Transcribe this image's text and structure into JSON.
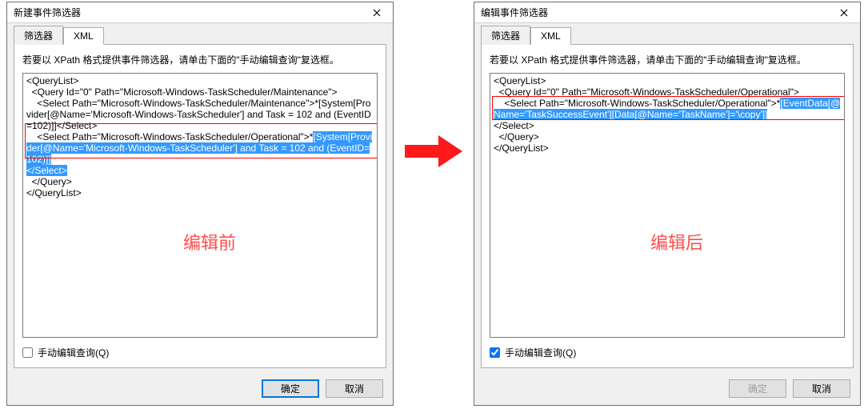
{
  "left": {
    "title": "新建事件筛选器",
    "tab_filter": "筛选器",
    "tab_xml": "XML",
    "instruction": "若要以 XPath 格式提供事件筛选器，请单击下面的\"手动编辑查询\"复选框。",
    "xml_lines": [
      "<QueryList>",
      "  <Query Id=\"0\" Path=\"Microsoft-Windows-TaskScheduler/Maintenance\">",
      "    <Select Path=\"Microsoft-Windows-TaskScheduler/Maintenance\">*[System[Provider[@Name='Microsoft-Windows-TaskScheduler'] and Task = 102 and (EventID=102)]]</Select>",
      "    <Select Path=\"Microsoft-Windows-TaskScheduler/Operational\">*",
      "</Select>",
      "  </Query>",
      "</QueryList>"
    ],
    "xml_highlight": "[System[Provider[@Name='Microsoft-Windows-TaskScheduler'] and Task = 102 and (EventID=102)]]",
    "xml_sel_prefix": "    <Select Path=\"Microsoft-Windows-TaskScheduler/Operational\">*",
    "checkbox_label": "手动编辑查询(Q)",
    "checkbox_checked": false,
    "ok": "确定",
    "cancel": "取消",
    "annotation": "编辑前"
  },
  "right": {
    "title": "编辑事件筛选器",
    "tab_filter": "筛选器",
    "tab_xml": "XML",
    "instruction": "若要以 XPath 格式提供事件筛选器，请单击下面的\"手动编辑查询\"复选框。",
    "xml_q1": "<QueryList>",
    "xml_q2": "  <Query Id=\"0\" Path=\"Microsoft-Windows-TaskScheduler/Operational\">",
    "xml_sel_prefix": "    <Select Path=\"Microsoft-Windows-TaskScheduler/Operational\">*",
    "xml_highlight": "[EventData[@Name='TaskSuccessEvent'][Data[@Name='TaskName']='\\copy']]",
    "xml_sel_close": "</Select>",
    "xml_q3": "  </Query>",
    "xml_q4": "</QueryList>",
    "checkbox_label": "手动编辑查询(Q)",
    "checkbox_checked": true,
    "ok": "确定",
    "cancel": "取消",
    "annotation": "编辑后"
  }
}
